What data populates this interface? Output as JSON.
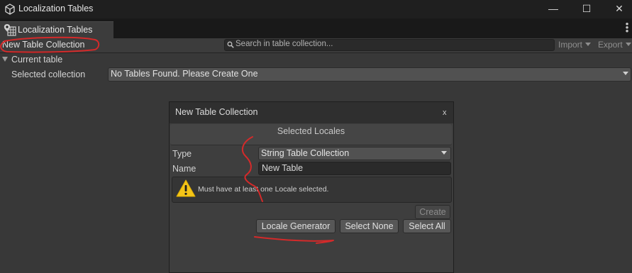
{
  "window": {
    "title": "Localization Tables",
    "minimize_glyph": "—",
    "maximize_glyph": "☐",
    "close_glyph": "✕",
    "icon": "unity-cube-icon"
  },
  "tab": {
    "label": "Localization Tables",
    "icon": "localization-tables-icon",
    "menu_glyph": "⋮"
  },
  "toolbar": {
    "new_collection_label": "New Table Collection",
    "search_placeholder": "Search in table collection...",
    "import_label": "Import",
    "export_label": "Export"
  },
  "main": {
    "current_table_label": "Current table",
    "selected_collection_label": "Selected collection",
    "selected_collection_value": "No Tables Found. Please Create One"
  },
  "dialog": {
    "title": "New Table Collection",
    "close_glyph": "x",
    "locales_header": "Selected Locales",
    "type_label": "Type",
    "type_value": "String Table Collection",
    "name_label": "Name",
    "name_value": "New Table",
    "help_message": "Must have at least one Locale selected.",
    "create_label": "Create",
    "locale_generator_label": "Locale Generator",
    "select_none_label": "Select None",
    "select_all_label": "Select All"
  },
  "colors": {
    "annotation": "#d42a2a",
    "warning": "#f5c518",
    "background": "#383838"
  }
}
